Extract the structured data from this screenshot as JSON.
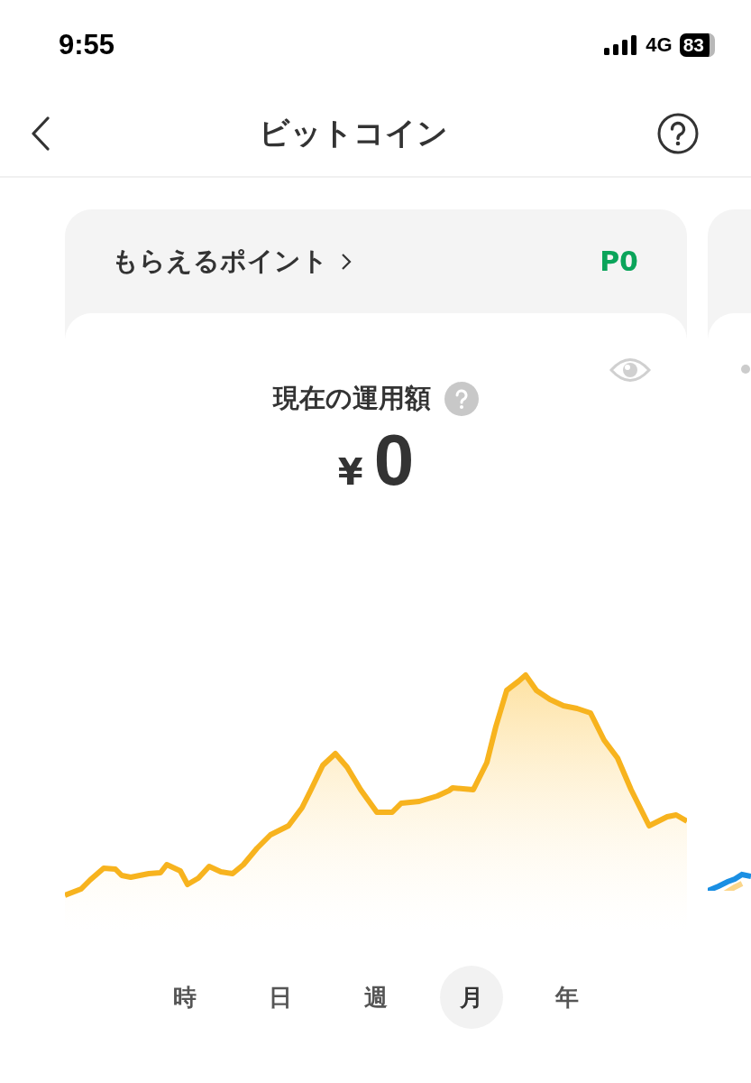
{
  "status_bar": {
    "time": "9:55",
    "network": "4G",
    "battery": "83"
  },
  "nav": {
    "title": "ビットコイン"
  },
  "card": {
    "points_label": "もらえるポイント",
    "points_value": "P0",
    "balance_label": "現在の運用額",
    "currency": "¥",
    "balance": "0",
    "periods": [
      {
        "label": "時",
        "selected": false
      },
      {
        "label": "日",
        "selected": false
      },
      {
        "label": "週",
        "selected": false
      },
      {
        "label": "月",
        "selected": true
      },
      {
        "label": "年",
        "selected": false
      }
    ]
  }
}
